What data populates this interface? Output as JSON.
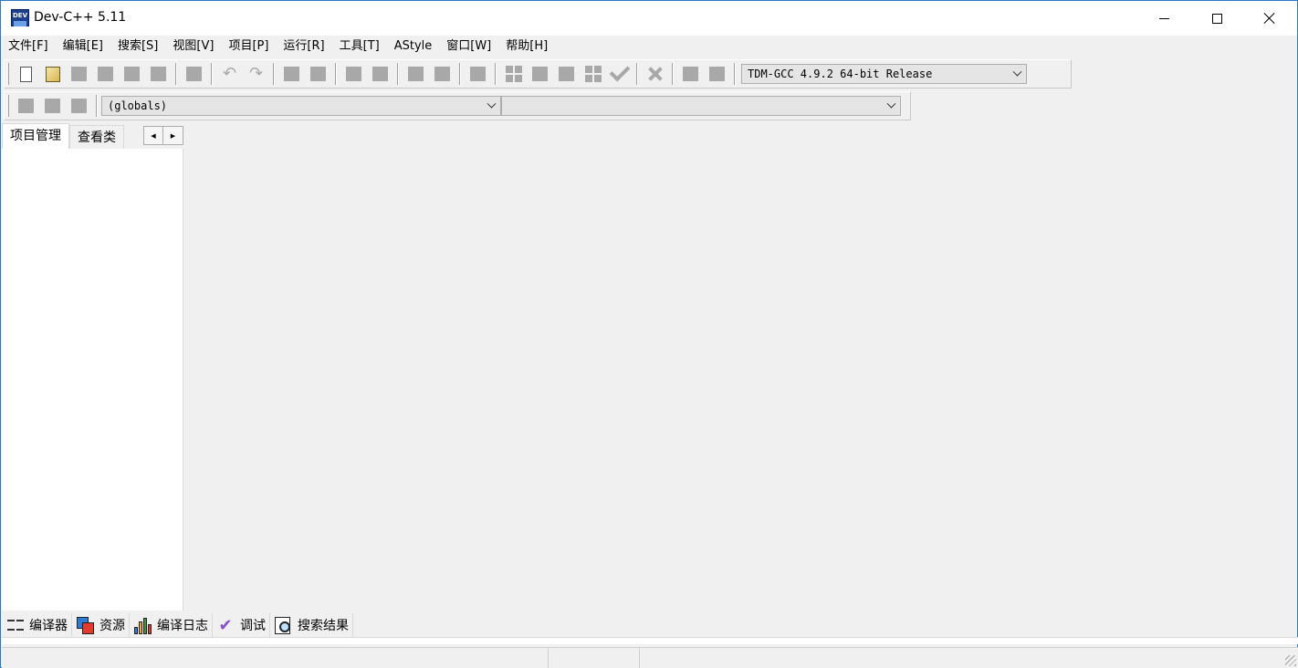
{
  "window": {
    "title": "Dev-C++ 5.11",
    "icon": "devcpp-app-icon",
    "icon_text": "DEV"
  },
  "menu": [
    "文件[F]",
    "编辑[E]",
    "搜索[S]",
    "视图[V]",
    "项目[P]",
    "运行[R]",
    "工具[T]",
    "AStyle",
    "窗口[W]",
    "帮助[H]"
  ],
  "toolbar": {
    "compiler_select": "TDM-GCC 4.9.2 64-bit Release"
  },
  "class_toolbar": {
    "scope_select": "(globals)",
    "member_select": ""
  },
  "left_panel": {
    "tabs": [
      "项目管理",
      "查看类"
    ],
    "active_tab": "项目管理"
  },
  "bottom_tabs": [
    "编译器",
    "资源",
    "编译日志",
    "调试",
    "搜索结果"
  ],
  "colors": {
    "window_border": "#2b78c5",
    "background": "#f0f0f0"
  }
}
